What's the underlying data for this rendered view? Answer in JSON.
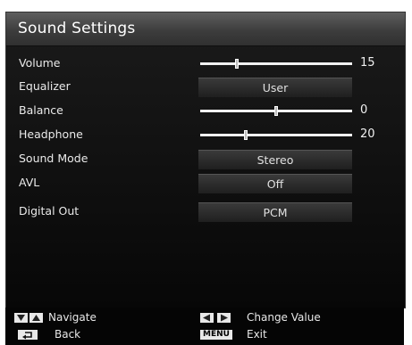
{
  "title": "Sound Settings",
  "rows": [
    {
      "label": "Volume",
      "type": "slider",
      "level": 0.24,
      "value": "15"
    },
    {
      "label": "Equalizer",
      "type": "select",
      "value": "User"
    },
    {
      "label": "Balance",
      "type": "slider",
      "level": 0.5,
      "value": "0"
    },
    {
      "label": "Headphone",
      "type": "slider",
      "level": 0.3,
      "value": "20"
    },
    {
      "label": "Sound Mode",
      "type": "select",
      "value": "Stereo"
    },
    {
      "label": "AVL",
      "type": "select",
      "value": "Off"
    },
    {
      "label": "Digital Out",
      "type": "select",
      "value": "PCM"
    }
  ],
  "footer": {
    "navigate": "Navigate",
    "back": "Back",
    "change_value": "Change Value",
    "menu_key": "MENU",
    "exit": "Exit"
  },
  "icons": [
    "down-arrow-icon",
    "up-arrow-icon",
    "return-icon",
    "left-arrow-icon",
    "right-arrow-icon"
  ]
}
